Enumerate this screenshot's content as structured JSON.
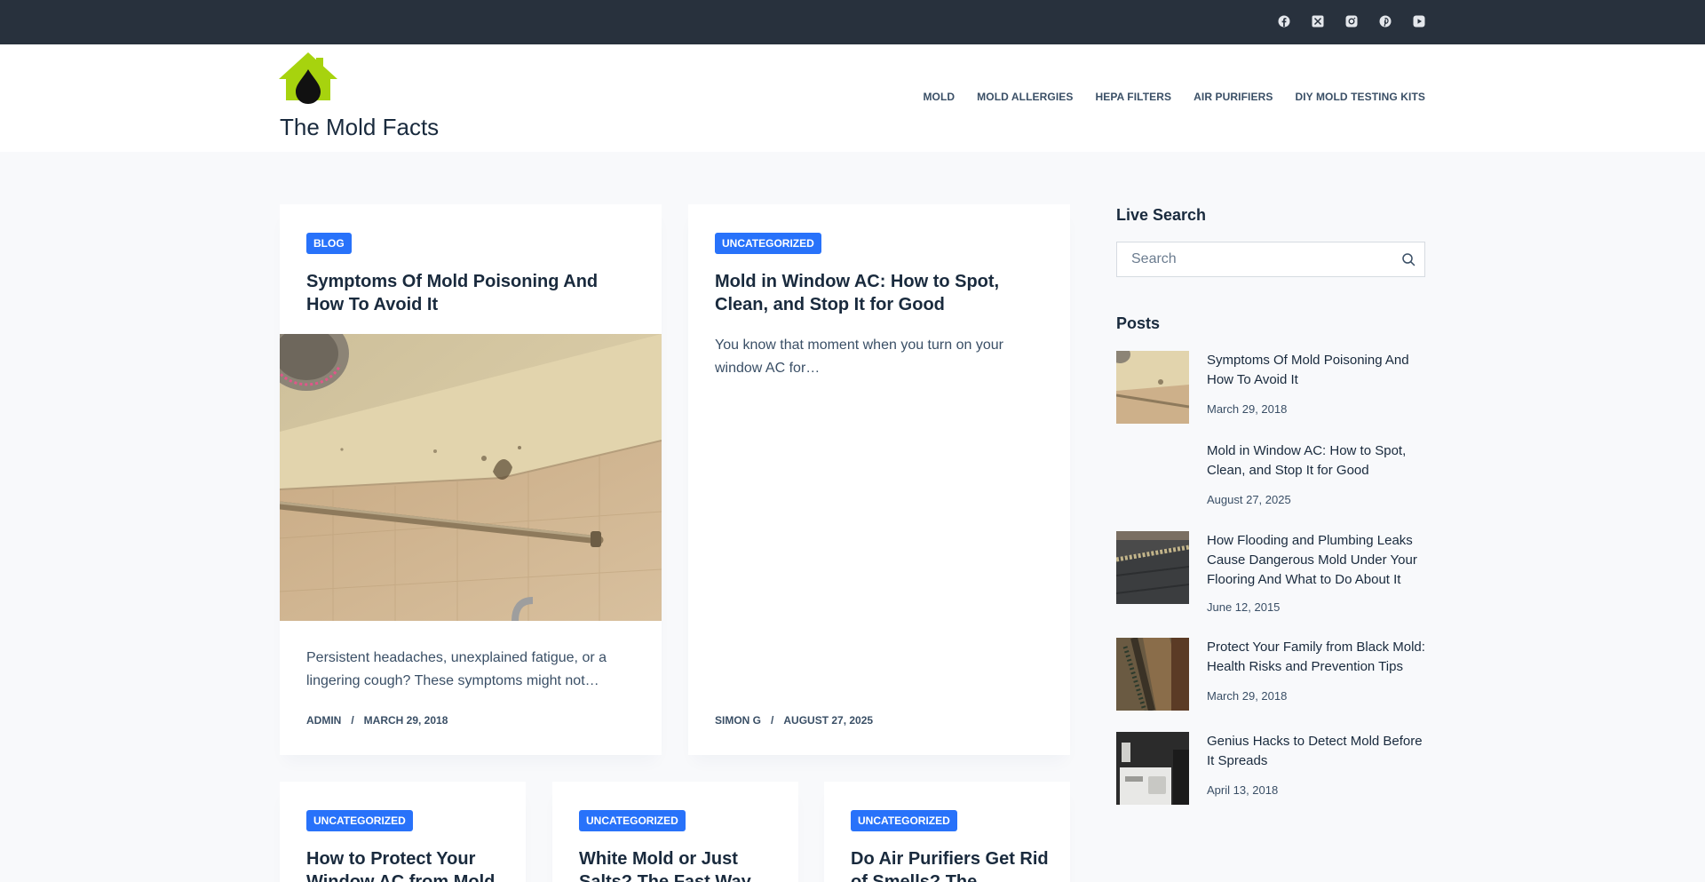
{
  "colors": {
    "accent": "#2872fa",
    "topbar": "#28313d",
    "logo_green": "#a7d30e"
  },
  "topbar": {
    "icons": [
      "facebook-icon",
      "x-twitter-icon",
      "instagram-icon",
      "pinterest-icon",
      "youtube-icon"
    ]
  },
  "header": {
    "site_title": "The Mold Facts",
    "nav": [
      "MOLD",
      "MOLD ALLERGIES",
      "HEPA FILTERS",
      "AIR PURIFIERS",
      "DIY MOLD TESTING KITS"
    ]
  },
  "articles": [
    {
      "category": "BLOG",
      "title": "Symptoms Of Mold Poisoning And How To Avoid It",
      "excerpt": "Persistent headaches, unexplained fatigue, or a lingering cough? These symptoms might not…",
      "author": "ADMIN",
      "separator": "/",
      "date": "MARCH 29, 2018"
    },
    {
      "category": "UNCATEGORIZED",
      "title": "Mold in Window AC: How to Spot, Clean, and Stop It for Good",
      "excerpt": "You know that moment when you turn on your window AC for…",
      "author": "SIMON G",
      "separator": "/",
      "date": "AUGUST 27, 2025"
    },
    {
      "category": "UNCATEGORIZED",
      "title": "How to Protect Your Window AC from Mold"
    },
    {
      "category": "UNCATEGORIZED",
      "title": "White Mold or Just Salts? The Fast Way"
    },
    {
      "category": "UNCATEGORIZED",
      "title": "Do Air Purifiers Get Rid of Smells? The"
    }
  ],
  "sidebar": {
    "live_search_heading": "Live Search",
    "search_placeholder": "Search",
    "posts_heading": "Posts",
    "posts": [
      {
        "title": "Symptoms Of Mold Poisoning And How To Avoid It",
        "date": "March 29, 2018"
      },
      {
        "title": "Mold in Window AC: How to Spot, Clean, and Stop It for Good",
        "date": "August 27, 2025"
      },
      {
        "title": "How Flooding and Plumbing Leaks Cause Dangerous Mold Under Your Flooring And What to Do About It",
        "date": "June 12, 2015"
      },
      {
        "title": "Protect Your Family from Black Mold: Health Risks and Prevention Tips",
        "date": "March 29, 2018"
      },
      {
        "title": "Genius Hacks to Detect Mold Before It Spreads",
        "date": "April 13, 2018"
      }
    ]
  }
}
